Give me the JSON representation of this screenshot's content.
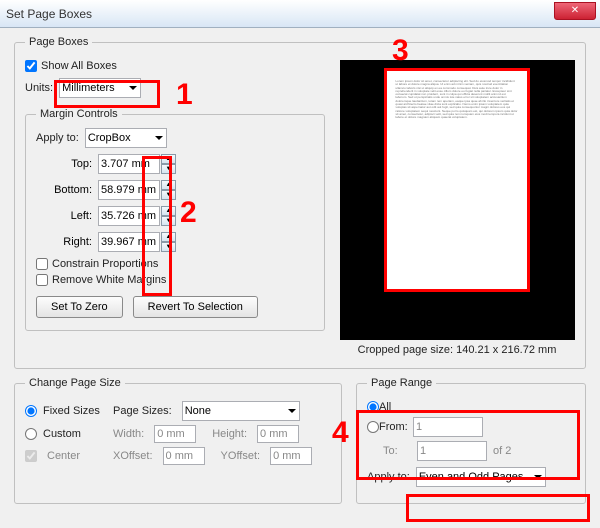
{
  "window": {
    "title": "Set Page Boxes"
  },
  "page_boxes": {
    "legend": "Page Boxes",
    "show_all": "Show All Boxes",
    "units_label": "Units:",
    "units_value": "Millimeters"
  },
  "margin_controls": {
    "legend": "Margin Controls",
    "apply_to_label": "Apply to:",
    "apply_to_value": "CropBox",
    "top_label": "Top:",
    "top_value": "3.707 mm",
    "bottom_label": "Bottom:",
    "bottom_value": "58.979 mm",
    "left_label": "Left:",
    "left_value": "35.726 mm",
    "right_label": "Right:",
    "right_value": "39.967 mm",
    "constrain": "Constrain Proportions",
    "remove_white": "Remove White Margins",
    "set_zero": "Set To Zero",
    "revert": "Revert To Selection"
  },
  "preview": {
    "cropped_label": "Cropped page size: 140.21 x 216.72 mm"
  },
  "change_page_size": {
    "legend": "Change Page Size",
    "fixed": "Fixed Sizes",
    "custom": "Custom",
    "center": "Center",
    "page_sizes_label": "Page Sizes:",
    "page_sizes_value": "None",
    "width_label": "Width:",
    "width_value": "0 mm",
    "height_label": "Height:",
    "height_value": "0 mm",
    "xoffset_label": "XOffset:",
    "xoffset_value": "0 mm",
    "yoffset_label": "YOffset:",
    "yoffset_value": "0 mm"
  },
  "page_range": {
    "legend": "Page Range",
    "all": "All",
    "from": "From:",
    "from_value": "1",
    "to": "To:",
    "to_value": "1",
    "of": "of 2",
    "apply_to_label": "Apply to:",
    "apply_to_value": "Even and Odd Pages"
  },
  "callouts": {
    "c1": "1",
    "c2": "2",
    "c3": "3",
    "c4": "4"
  }
}
